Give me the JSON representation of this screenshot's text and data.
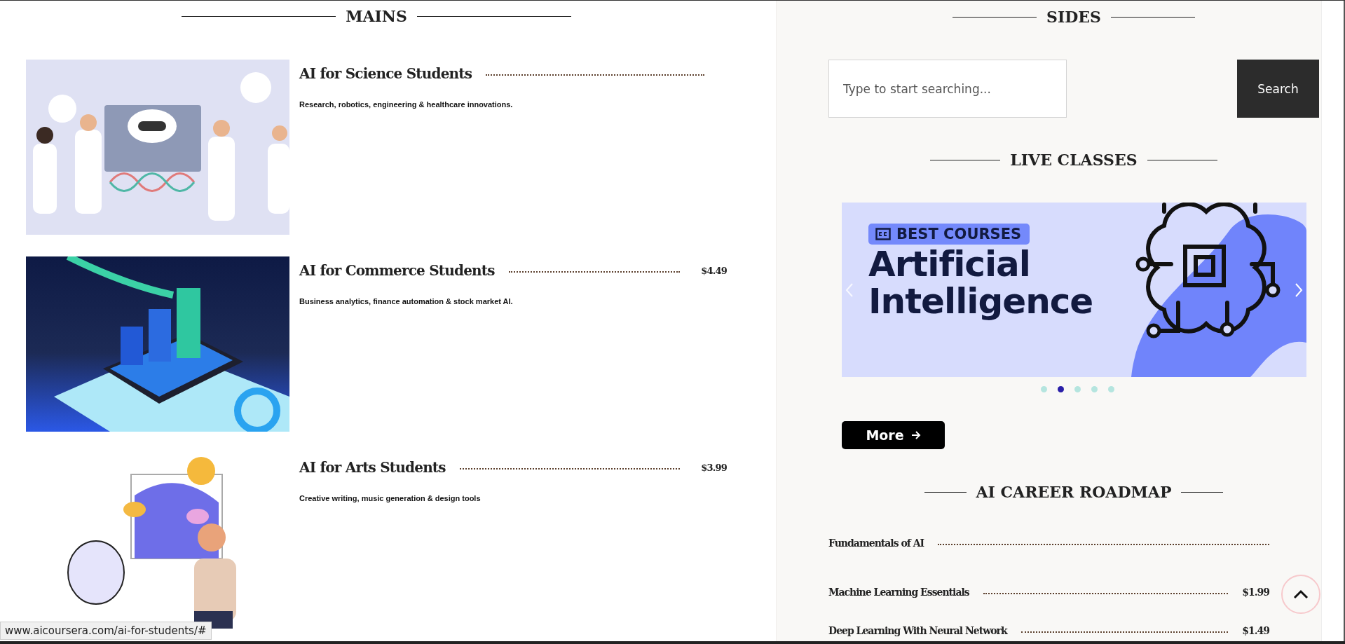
{
  "mains": {
    "heading": "MAINS",
    "items": [
      {
        "kind": "science",
        "title": "AI for Science Students",
        "description": "Research, robotics, engineering & healthcare innovations."
      },
      {
        "kind": "commerce",
        "title": "AI for Commerce Students",
        "price": "$4.49",
        "description": "Business analytics, finance automation & stock market AI."
      },
      {
        "kind": "arts",
        "title": "AI for Arts Students",
        "price": "$3.99",
        "description": "Creative writing, music generation & design tools"
      }
    ]
  },
  "sides": {
    "heading": "SIDES",
    "search": {
      "placeholder": "Type to start searching...",
      "button": "Search"
    }
  },
  "live_classes": {
    "heading": "LIVE CLASSES",
    "banner": {
      "badge": "BEST COURSES",
      "title": "Artificial Intelligence"
    },
    "dots": [
      {
        "selected": false
      },
      {
        "selected": true
      },
      {
        "selected": false
      },
      {
        "selected": false
      },
      {
        "selected": false
      }
    ],
    "more_button": "More"
  },
  "roadmap": {
    "heading": "AI CAREER ROADMAP",
    "items": [
      {
        "title": "Fundamentals of AI"
      },
      {
        "title": "Machine Learning Essentials",
        "price": "$1.99"
      },
      {
        "title": "Deep Learning With Neural Network",
        "price": "$1.49"
      }
    ]
  },
  "status_bar": "www.aicoursera.com/ai-for-students/#"
}
